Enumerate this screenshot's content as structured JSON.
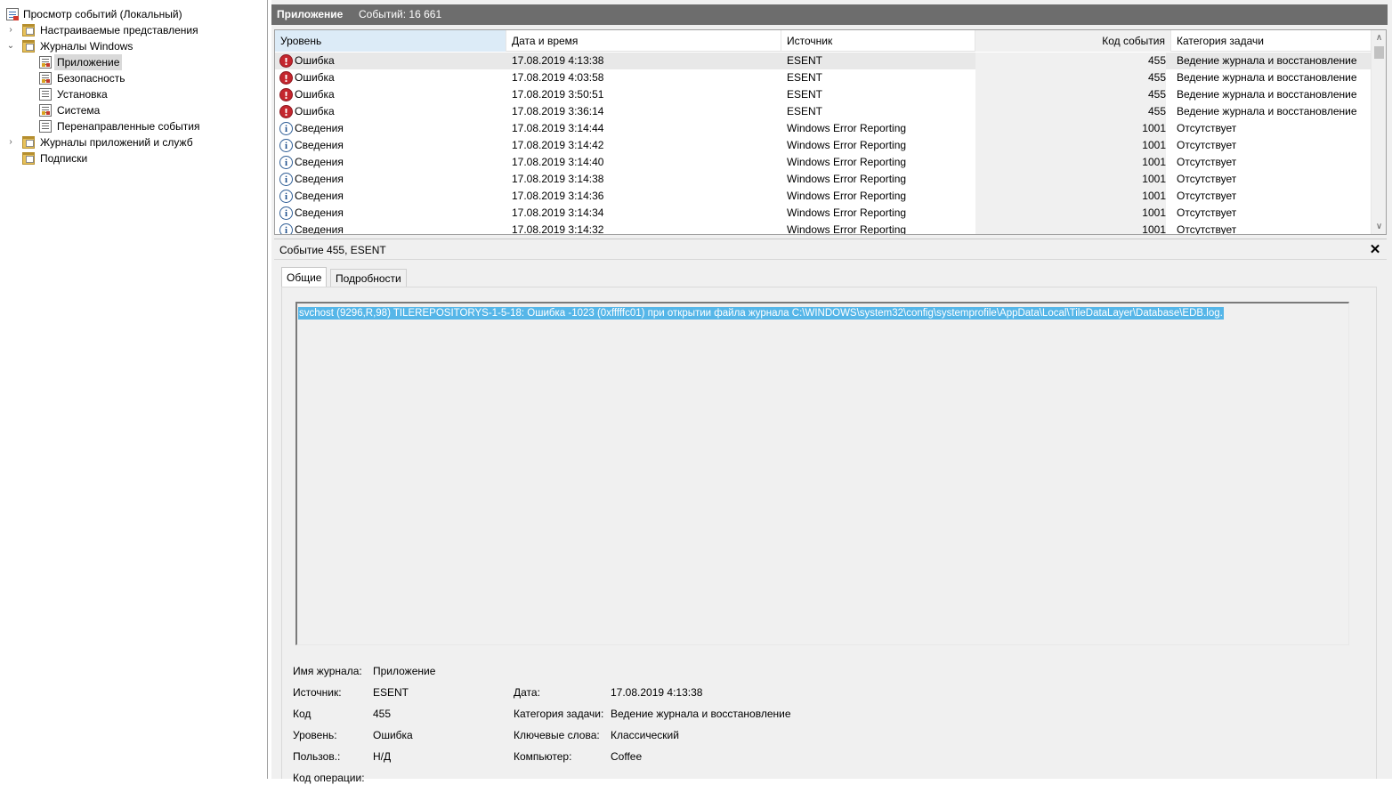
{
  "tree": {
    "root": "Просмотр событий (Локальный)",
    "custom_views": "Настраиваемые представления",
    "windows_logs": "Журналы Windows",
    "children": [
      "Приложение",
      "Безопасность",
      "Установка",
      "Система",
      "Перенаправленные события"
    ],
    "app_service_logs": "Журналы приложений и служб",
    "subscriptions": "Подписки"
  },
  "pane": {
    "title": "Приложение",
    "count_label": "Событий: 16 661"
  },
  "grid": {
    "columns": [
      "Уровень",
      "Дата и время",
      "Источник",
      "Код события",
      "Категория задачи"
    ],
    "rows": [
      {
        "level": "Ошибка",
        "type": "error",
        "date": "17.08.2019 4:13:38",
        "source": "ESENT",
        "code": "455",
        "category": "Ведение журнала и восстановление"
      },
      {
        "level": "Ошибка",
        "type": "error",
        "date": "17.08.2019 4:03:58",
        "source": "ESENT",
        "code": "455",
        "category": "Ведение журнала и восстановление"
      },
      {
        "level": "Ошибка",
        "type": "error",
        "date": "17.08.2019 3:50:51",
        "source": "ESENT",
        "code": "455",
        "category": "Ведение журнала и восстановление"
      },
      {
        "level": "Ошибка",
        "type": "error",
        "date": "17.08.2019 3:36:14",
        "source": "ESENT",
        "code": "455",
        "category": "Ведение журнала и восстановление"
      },
      {
        "level": "Сведения",
        "type": "info",
        "date": "17.08.2019 3:14:44",
        "source": "Windows Error Reporting",
        "code": "1001",
        "category": "Отсутствует"
      },
      {
        "level": "Сведения",
        "type": "info",
        "date": "17.08.2019 3:14:42",
        "source": "Windows Error Reporting",
        "code": "1001",
        "category": "Отсутствует"
      },
      {
        "level": "Сведения",
        "type": "info",
        "date": "17.08.2019 3:14:40",
        "source": "Windows Error Reporting",
        "code": "1001",
        "category": "Отсутствует"
      },
      {
        "level": "Сведения",
        "type": "info",
        "date": "17.08.2019 3:14:38",
        "source": "Windows Error Reporting",
        "code": "1001",
        "category": "Отсутствует"
      },
      {
        "level": "Сведения",
        "type": "info",
        "date": "17.08.2019 3:14:36",
        "source": "Windows Error Reporting",
        "code": "1001",
        "category": "Отсутствует"
      },
      {
        "level": "Сведения",
        "type": "info",
        "date": "17.08.2019 3:14:34",
        "source": "Windows Error Reporting",
        "code": "1001",
        "category": "Отсутствует"
      },
      {
        "level": "Сведения",
        "type": "info",
        "date": "17.08.2019 3:14:32",
        "source": "Windows Error Reporting",
        "code": "1001",
        "category": "Отсутствует"
      }
    ]
  },
  "detail": {
    "title": "Событие 455, ESENT",
    "tabs": [
      "Общие",
      "Подробности"
    ],
    "message": "svchost (9296,R,98) TILEREPOSITORYS-1-5-18: Ошибка -1023 (0xfffffc01) при открытии файла журнала C:\\WINDOWS\\system32\\config\\systemprofile\\AppData\\Local\\TileDataLayer\\Database\\EDB.log.",
    "props": {
      "log_name_label": "Имя журнала:",
      "log_name": "Приложение",
      "source_label": "Источник:",
      "source": "ESENT",
      "code_label": "Код",
      "code": "455",
      "level_label": "Уровень:",
      "level": "Ошибка",
      "user_label": "Пользов.:",
      "user": "Н/Д",
      "opcode_label": "Код операции:",
      "date_label": "Дата:",
      "date": "17.08.2019 4:13:38",
      "category_label": "Категория задачи:",
      "category": "Ведение журнала и восстановление",
      "keywords_label": "Ключевые слова:",
      "keywords": "Классический",
      "computer_label": "Компьютер:",
      "computer": "Coffee"
    }
  },
  "colors": {
    "header_bg": "#6d6d6d",
    "selection_blue": "#56b6e8",
    "error_red": "#c4262e"
  }
}
